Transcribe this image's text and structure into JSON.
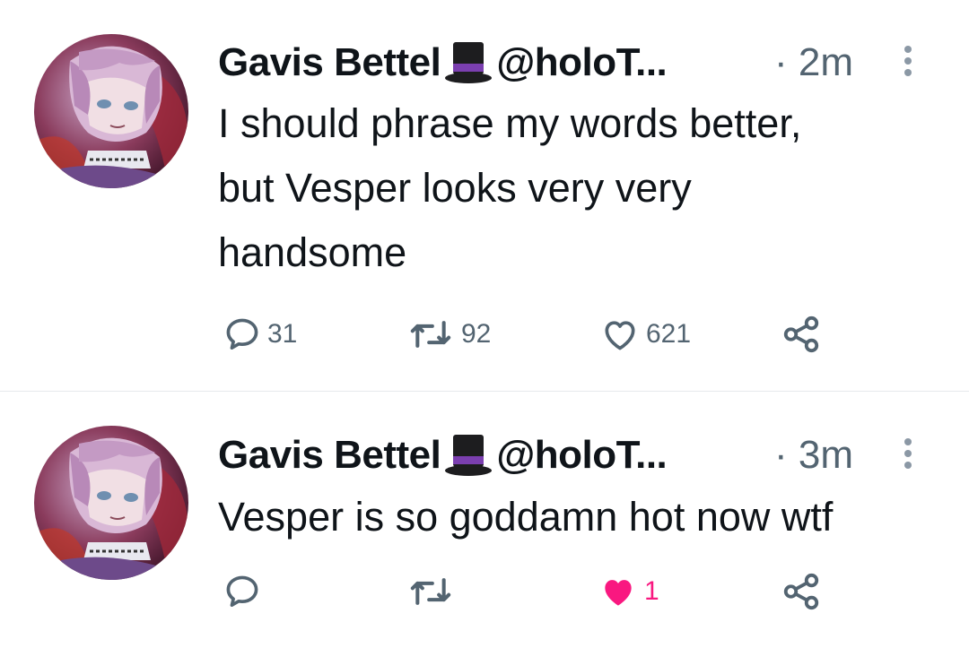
{
  "tweets": [
    {
      "author_name": "Gavis Bettel",
      "name_emoji": "top-hat-icon",
      "handle": "@holoT...",
      "time": "· 2m",
      "text_lines": [
        "I should phrase my words better,",
        "but Vesper looks very very",
        "handsome"
      ],
      "replies": "31",
      "retweets": "92",
      "likes": "621",
      "liked": false
    },
    {
      "author_name": "Gavis Bettel",
      "name_emoji": "top-hat-icon",
      "handle": "@holoT...",
      "time": "· 3m",
      "text_lines": [
        "Vesper is so goddamn hot now wtf"
      ],
      "replies": "",
      "retweets": "",
      "likes": "1",
      "liked": true
    }
  ],
  "colors": {
    "text": "#0f1419",
    "secondary": "#536471",
    "like_active": "#f91880",
    "divider": "#e6e9ec"
  }
}
